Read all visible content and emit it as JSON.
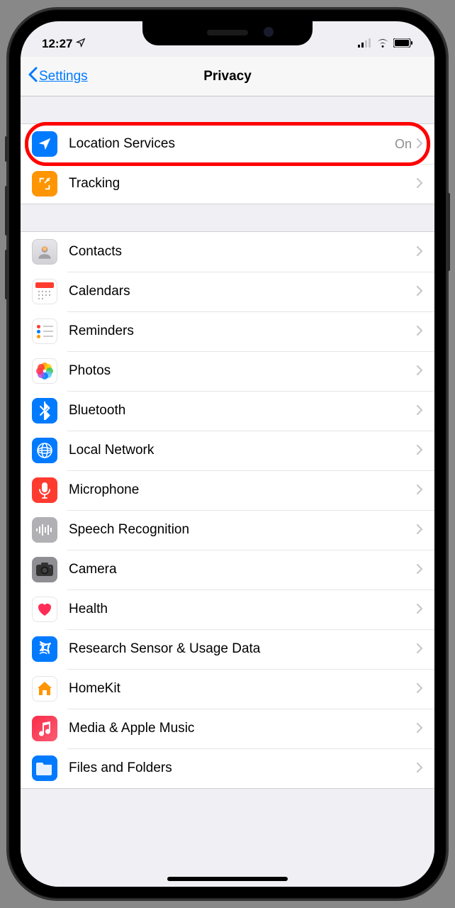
{
  "statusBar": {
    "time": "12:27"
  },
  "nav": {
    "back": "Settings",
    "title": "Privacy"
  },
  "sections": [
    {
      "rows": [
        {
          "id": "location-services",
          "label": "Location Services",
          "value": "On",
          "icon": "location",
          "highlighted": true
        },
        {
          "id": "tracking",
          "label": "Tracking",
          "icon": "tracking"
        }
      ]
    },
    {
      "rows": [
        {
          "id": "contacts",
          "label": "Contacts",
          "icon": "contacts"
        },
        {
          "id": "calendars",
          "label": "Calendars",
          "icon": "calendars"
        },
        {
          "id": "reminders",
          "label": "Reminders",
          "icon": "reminders"
        },
        {
          "id": "photos",
          "label": "Photos",
          "icon": "photos"
        },
        {
          "id": "bluetooth",
          "label": "Bluetooth",
          "icon": "bluetooth"
        },
        {
          "id": "local-network",
          "label": "Local Network",
          "icon": "localnet"
        },
        {
          "id": "microphone",
          "label": "Microphone",
          "icon": "mic"
        },
        {
          "id": "speech-recognition",
          "label": "Speech Recognition",
          "icon": "speech"
        },
        {
          "id": "camera",
          "label": "Camera",
          "icon": "camera"
        },
        {
          "id": "health",
          "label": "Health",
          "icon": "health"
        },
        {
          "id": "research",
          "label": "Research Sensor & Usage Data",
          "icon": "research"
        },
        {
          "id": "homekit",
          "label": "HomeKit",
          "icon": "homekit"
        },
        {
          "id": "media",
          "label": "Media & Apple Music",
          "icon": "media"
        },
        {
          "id": "files",
          "label": "Files and Folders",
          "icon": "files"
        }
      ]
    }
  ]
}
